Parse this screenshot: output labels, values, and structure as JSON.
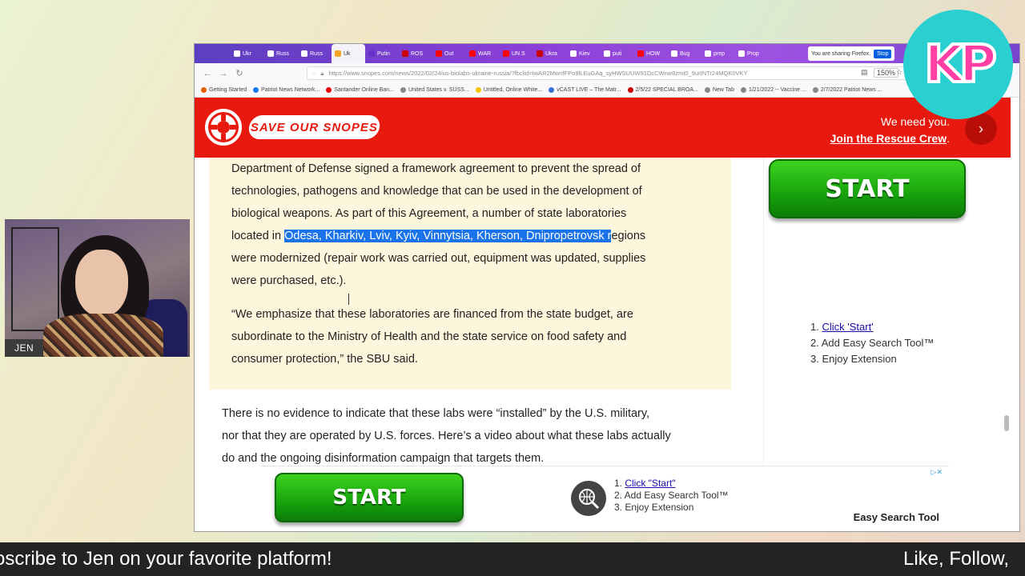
{
  "browser": {
    "tabs": [
      {
        "label": "Ukr",
        "color": "#ffffff"
      },
      {
        "label": "Russ",
        "color": "#ffffff"
      },
      {
        "label": "Russ",
        "color": "#ffffff"
      },
      {
        "label": "Uk",
        "color": "#f5a623",
        "active": true
      },
      {
        "label": "Putin",
        "color": "#6b2fd0"
      },
      {
        "label": "ROS",
        "color": "#cc0000"
      },
      {
        "label": "Out",
        "color": "#ff0000"
      },
      {
        "label": "WAR",
        "color": "#ff0000"
      },
      {
        "label": "UN S",
        "color": "#ff0000"
      },
      {
        "label": "Ukra",
        "color": "#cc0000"
      },
      {
        "label": "Kiev",
        "color": "#ffffff"
      },
      {
        "label": "puti",
        "color": "#ffffff"
      },
      {
        "label": "HOW",
        "color": "#ff0000"
      },
      {
        "label": "Bug",
        "color": "#ffffff"
      },
      {
        "label": "prep",
        "color": "#ffffff"
      },
      {
        "label": "Prop",
        "color": "#ffffff"
      }
    ],
    "sharing_text": "You are sharing Firefox.",
    "stop_label": "Stop",
    "url": "https://www.snopes.com/news/2022/02/24/us-biolabs-ukraine-russia/?fbclid=IwAR2MwnfFPo9lLEuGAq_syHWSUUW91DcCWnw9zmI0_9urINTr24MQK0VKY",
    "zoom": "150%",
    "bookmarks": [
      {
        "label": "Getting Started",
        "color": "#e66000"
      },
      {
        "label": "Patriot News Network...",
        "color": "#1877f2"
      },
      {
        "label": "Santander Online Ban...",
        "color": "#ec0000"
      },
      {
        "label": "United States v. SUSS...",
        "color": "#888888"
      },
      {
        "label": "Untitled, Online White...",
        "color": "#f5c400"
      },
      {
        "label": "vCAST LIVE – The Matr...",
        "color": "#3b6fd1"
      },
      {
        "label": "2/5/22 SPECIAL BROA...",
        "color": "#cc0000"
      },
      {
        "label": "New Tab",
        "color": "#888888"
      },
      {
        "label": "1/21/2022 -- Vaccine ...",
        "color": "#888888"
      },
      {
        "label": "2/7/2022 Patriot News ...",
        "color": "#888888"
      }
    ]
  },
  "banner": {
    "save_label": "SAVE OUR SNOPES",
    "need_line": "We need you.",
    "join_line": "Join the Rescue Crew",
    "join_punct": ".",
    "bg_color": "#e8190f"
  },
  "article": {
    "quote_lines": [
      "Department of Defense signed a framework agreement to prevent the spread of",
      "technologies, pathogens and knowledge that can be used in the development of",
      "biological weapons. As part of this Agreement, a number of state laboratories"
    ],
    "located_pre": "located in ",
    "located_highlight": "Odesa, Kharkiv, Lviv, Kyiv, Vinnytsia, Kherson, Dnipropetrovsk r",
    "located_post": "egions",
    "modernized_line": "were modernized (repair work was carried out, equipment was updated, supplies",
    "purchased_line": "were purchased, etc.).",
    "quote2_lines": [
      "“We emphasize that these laboratories are financed from the state budget, are",
      "subordinate to the Ministry of Health and the state service on food safety and",
      "consumer protection,” the SBU said."
    ],
    "body_lines": [
      "There is no evidence to indicate that these labs were “installed” by the U.S. military,",
      "nor that they are operated by U.S. forces. Here’s a video about what these labs actually",
      "do and the ongoing disinformation campaign that targets them."
    ]
  },
  "side_ad": {
    "start_label": "START",
    "steps": [
      "1. ",
      "Click 'Start'",
      "2. Add Easy Search Tool™",
      "3. Enjoy Extension"
    ]
  },
  "bottom_ad": {
    "start_label": "START",
    "step1_num": "1. ",
    "step1_link": "Click \"Start\"",
    "step2": "2. Add Easy Search Tool™",
    "step3": "3. Enjoy Extension",
    "brand": "Easy Search Tool"
  },
  "webcam": {
    "name": "JEN"
  },
  "logo": {
    "text": "KP"
  },
  "ticker": {
    "left_text": "oscribe to Jen on your favorite platform!",
    "right_text": "Like, Follow,"
  }
}
